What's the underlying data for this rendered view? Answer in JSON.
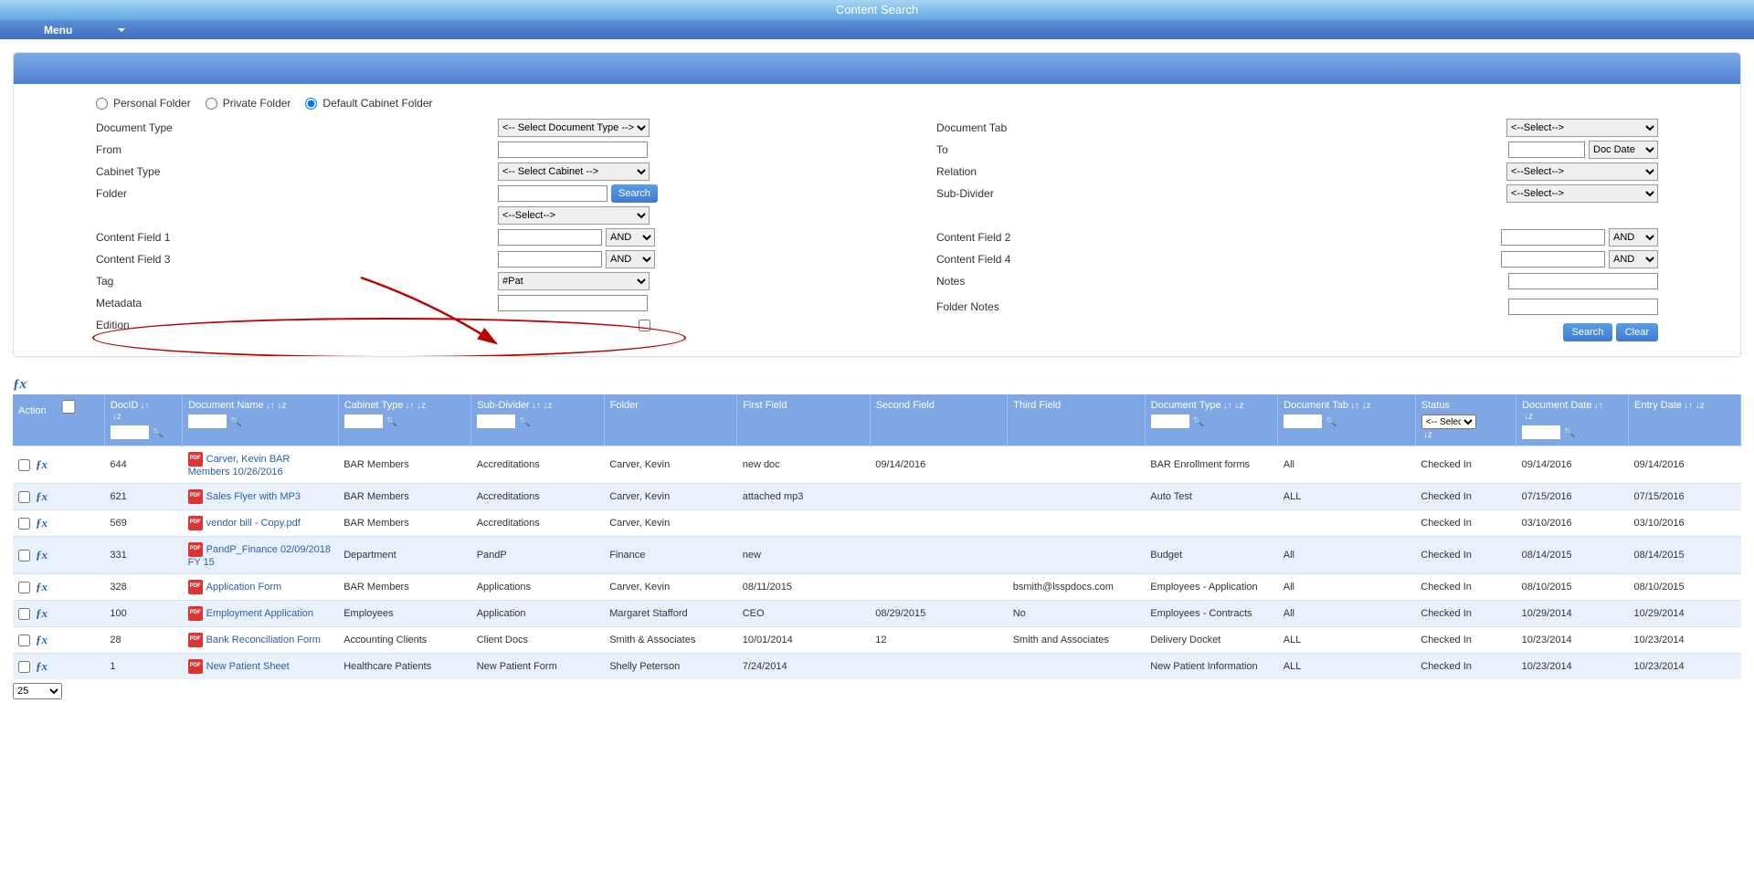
{
  "header": {
    "title": "Content Search"
  },
  "menu": {
    "label": "Menu"
  },
  "folderScope": {
    "personal": "Personal Folder",
    "private": "Private Folder",
    "default": "Default Cabinet Folder",
    "selected": "default"
  },
  "form": {
    "left": {
      "documentType": {
        "label": "Document Type",
        "option": "<-- Select Document Type -->"
      },
      "from": {
        "label": "From"
      },
      "cabinetType": {
        "label": "Cabinet Type",
        "option": "<-- Select Cabinet -->"
      },
      "folder": {
        "label": "Folder",
        "searchBtn": "Search",
        "subOption": "<--Select-->"
      },
      "cf1": {
        "label": "Content Field 1",
        "op": "AND"
      },
      "cf3": {
        "label": "Content Field 3",
        "op": "AND"
      },
      "tag": {
        "label": "Tag",
        "value": "#Pat"
      },
      "metadata": {
        "label": "Metadata"
      },
      "edition": {
        "label": "Edition"
      }
    },
    "right": {
      "documentTab": {
        "label": "Document Tab",
        "option": "<--Select-->"
      },
      "to": {
        "label": "To",
        "dateOpt": "Doc Date"
      },
      "relation": {
        "label": "Relation",
        "option": "<--Select-->"
      },
      "subDivider": {
        "label": "Sub-Divider",
        "option": "<--Select-->"
      },
      "cf2": {
        "label": "Content Field 2",
        "op": "AND"
      },
      "cf4": {
        "label": "Content Field 4",
        "op": "AND"
      },
      "notes": {
        "label": "Notes"
      },
      "folderNotes": {
        "label": "Folder Notes"
      }
    },
    "buttons": {
      "search": "Search",
      "clear": "Clear"
    }
  },
  "columns": {
    "action": "Action",
    "docid": "DocID",
    "docname": "Document Name",
    "cabtype": "Cabinet Type",
    "subdiv": "Sub-Divider",
    "folder": "Folder",
    "ff": "First Field",
    "sf": "Second Field",
    "tf": "Third Field",
    "doctype": "Document Type",
    "doctab": "Document Tab",
    "status": "Status",
    "statusOpt": "<-- Select",
    "docdate": "Document Date",
    "entrydate": "Entry Date"
  },
  "rows": [
    {
      "docid": "644",
      "docname": "Carver, Kevin BAR Members 10/26/2016",
      "cabtype": "BAR Members",
      "subdiv": "Accreditations",
      "folder": "Carver, Kevin",
      "ff": "new doc",
      "sf": "09/14/2016",
      "tf": "",
      "doctype": "BAR Enrollment forms",
      "doctab": "All",
      "status": "Checked In",
      "docdate": "09/14/2016",
      "entrydate": "09/14/2016"
    },
    {
      "docid": "621",
      "docname": "Sales Flyer with MP3",
      "cabtype": "BAR Members",
      "subdiv": "Accreditations",
      "folder": "Carver, Kevin",
      "ff": "attached mp3",
      "sf": "",
      "tf": "",
      "doctype": "Auto Test",
      "doctab": "ALL",
      "status": "Checked In",
      "docdate": "07/15/2016",
      "entrydate": "07/15/2016"
    },
    {
      "docid": "569",
      "docname": "vendor bill - Copy.pdf",
      "cabtype": "BAR Members",
      "subdiv": "Accreditations",
      "folder": "Carver, Kevin",
      "ff": "",
      "sf": "",
      "tf": "",
      "doctype": "",
      "doctab": "",
      "status": "Checked In",
      "docdate": "03/10/2016",
      "entrydate": "03/10/2016"
    },
    {
      "docid": "331",
      "docname": "PandP_Finance 02/09/2018 FY 15",
      "cabtype": "Department",
      "subdiv": "PandP",
      "folder": "Finance",
      "ff": "new",
      "sf": "",
      "tf": "",
      "doctype": "Budget",
      "doctab": "All",
      "status": "Checked In",
      "docdate": "08/14/2015",
      "entrydate": "08/14/2015"
    },
    {
      "docid": "328",
      "docname": "Application Form",
      "cabtype": "BAR Members",
      "subdiv": "Applications",
      "folder": "Carver, Kevin",
      "ff": "08/11/2015",
      "sf": "",
      "tf": "bsmith@lsspdocs.com",
      "doctype": "Employees - Application",
      "doctab": "All",
      "status": "Checked In",
      "docdate": "08/10/2015",
      "entrydate": "08/10/2015"
    },
    {
      "docid": "100",
      "docname": "Employment Application",
      "cabtype": "Employees",
      "subdiv": "Application",
      "folder": "Margaret Stafford",
      "ff": "CEO",
      "sf": "08/29/2015",
      "tf": "No",
      "doctype": "Employees - Contracts",
      "doctab": "All",
      "status": "Checked In",
      "docdate": "10/29/2014",
      "entrydate": "10/29/2014"
    },
    {
      "docid": "28",
      "docname": "Bank Reconciliation Form",
      "cabtype": "Accounting Clients",
      "subdiv": "Client Docs",
      "folder": "Smith & Associates",
      "ff": "10/01/2014",
      "sf": "12",
      "tf": "Smith and Associates",
      "doctype": "Delivery Docket",
      "doctab": "ALL",
      "status": "Checked In",
      "docdate": "10/23/2014",
      "entrydate": "10/23/2014"
    },
    {
      "docid": "1",
      "docname": "New Patient Sheet",
      "cabtype": "Healthcare Patients",
      "subdiv": "New Patient Form",
      "folder": "Shelly Peterson",
      "ff": "7/24/2014",
      "sf": "",
      "tf": "",
      "doctype": "New Patient Information",
      "doctab": "ALL",
      "status": "Checked In",
      "docdate": "10/23/2014",
      "entrydate": "10/23/2014"
    }
  ],
  "pager": {
    "size": "25"
  }
}
